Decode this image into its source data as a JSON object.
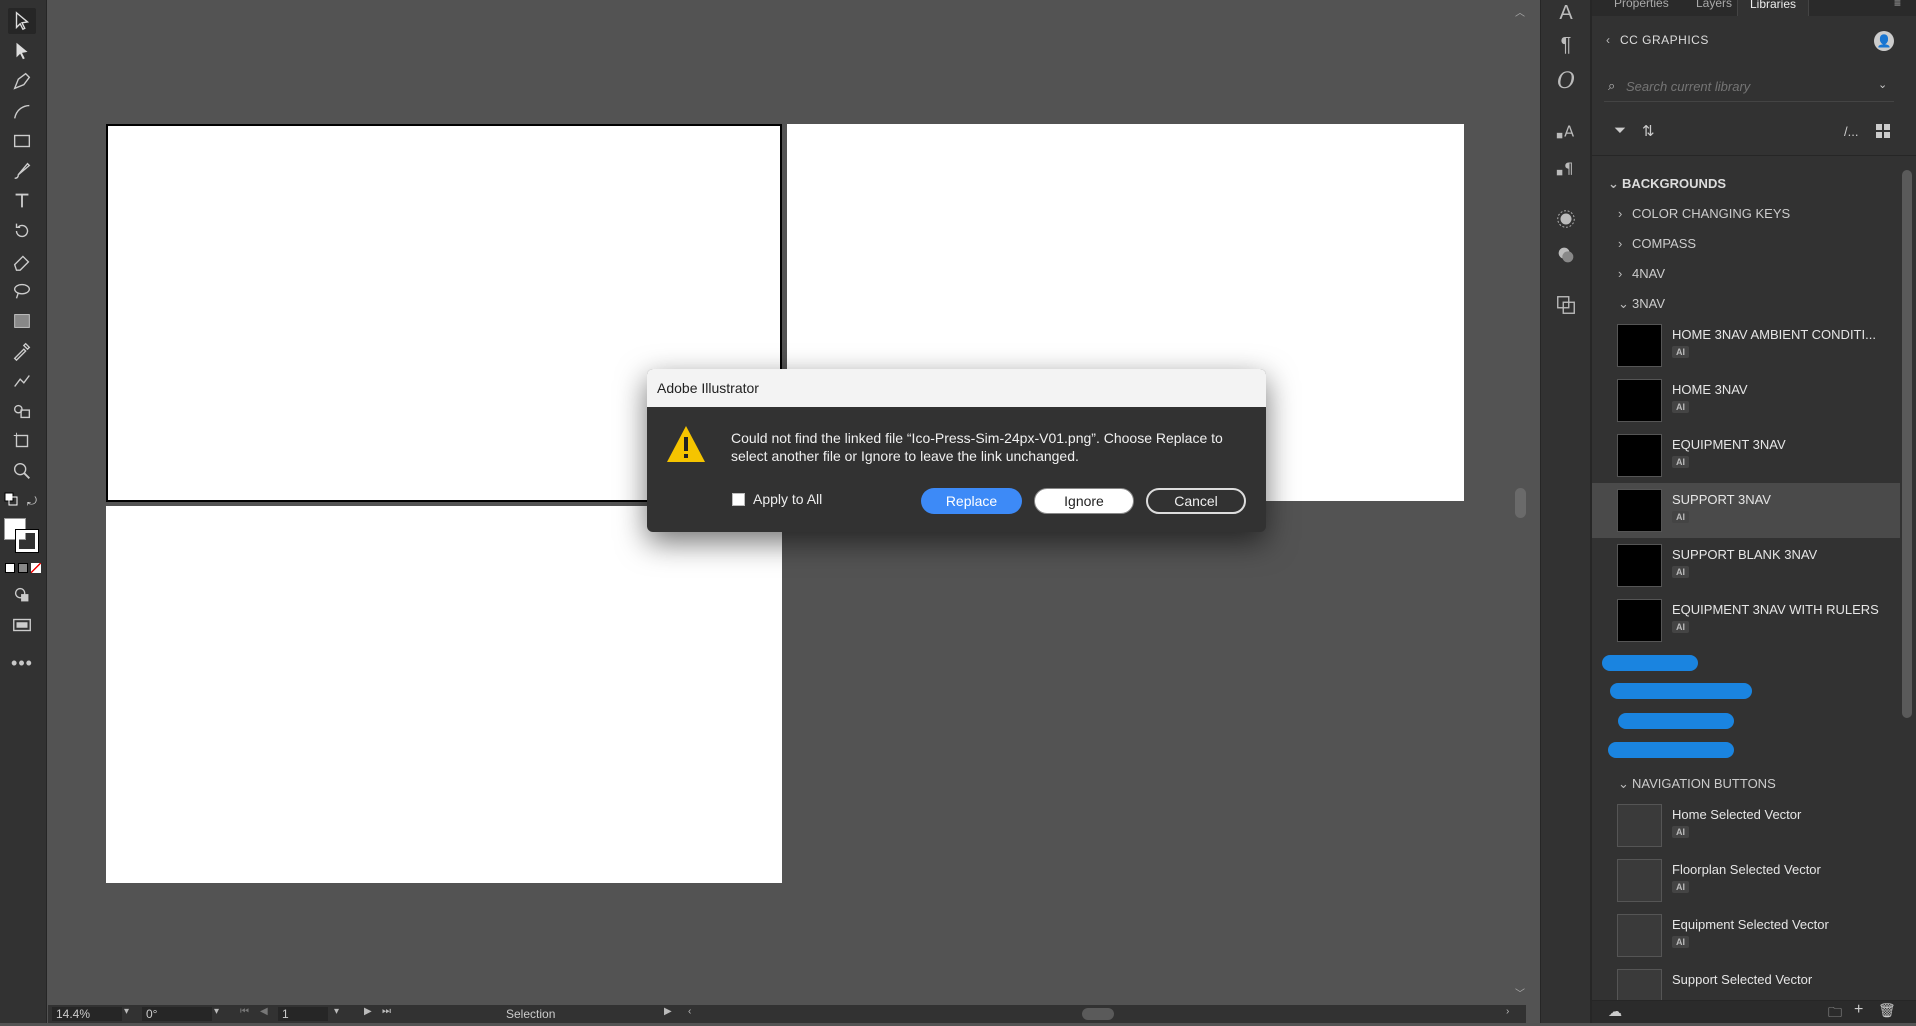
{
  "panel": {
    "tabs": [
      "Properties",
      "Layers",
      "Libraries"
    ],
    "library_name": "CC GRAPHICS",
    "search_placeholder": "Search current library",
    "backgrounds_label": "BACKGROUNDS",
    "groups": [
      "COLOR CHANGING KEYS",
      "COMPASS",
      "4NAV",
      "3NAV"
    ],
    "items_3nav": [
      {
        "name": "HOME 3NAV AMBIENT CONDITI...",
        "tag": "AI"
      },
      {
        "name": "HOME 3NAV",
        "tag": "AI"
      },
      {
        "name": "EQUIPMENT 3NAV",
        "tag": "AI"
      },
      {
        "name": "SUPPORT 3NAV",
        "tag": "AI"
      },
      {
        "name": "SUPPORT BLANK 3NAV",
        "tag": "AI"
      },
      {
        "name": "EQUIPMENT 3NAV WITH RULERS",
        "tag": "AI"
      }
    ],
    "nav_buttons_label": "NAVIGATION BUTTONS",
    "items_nav": [
      {
        "name": "Home Selected Vector",
        "tag": "AI"
      },
      {
        "name": "Floorplan Selected Vector",
        "tag": "AI"
      },
      {
        "name": "Equipment Selected Vector",
        "tag": "AI"
      },
      {
        "name": "Support Selected Vector",
        "tag": ""
      }
    ],
    "view_toggle": "/..."
  },
  "status": {
    "zoom": "14.4%",
    "rotation": "0°",
    "artboard": "1",
    "tool": "Selection"
  },
  "dialog": {
    "title": "Adobe Illustrator",
    "message": "Could not find the linked file “Ico-Press-Sim-24px-V01.png”. Choose Replace to select another file or Ignore to leave the link unchanged.",
    "apply_all": "Apply to All",
    "replace": "Replace",
    "ignore": "Ignore",
    "cancel": "Cancel"
  },
  "colors": {
    "accent": "#3d8af7",
    "warning": "#f5c400"
  }
}
